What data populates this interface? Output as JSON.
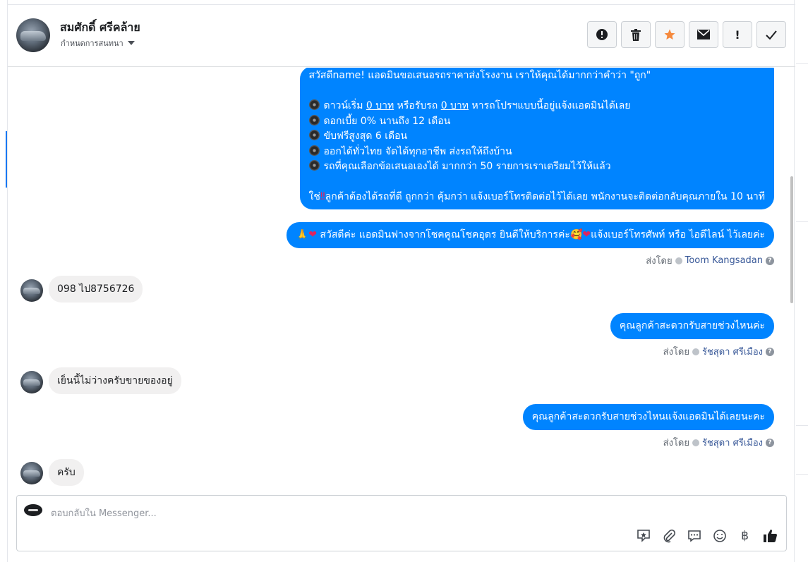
{
  "header": {
    "name": "สมศักดิ์ ศรีคล้าย",
    "subtitle": "กำหนดการสนทนา",
    "toolbar": {
      "alert_label": "!",
      "delete_label": "🗑",
      "star_label": "★",
      "mail_label": "✉",
      "important_label": "!",
      "done_label": "✓"
    }
  },
  "messages": {
    "promo": {
      "line1": "สวัสดีname! แอดมินขอเสนอรถราคาส่งโรงงาน เราให้คุณได้มากกว่าคำว่า \"ถูก\"",
      "l2a": "ดาวน์เริ่ม ",
      "l2b": "0 บาท",
      "l2c": " หรือรับรถ ",
      "l2d": "0 บาท",
      "l2e": " หารถโปรฯแบบนี้อยู่แจ้งแอดมินได้เลย",
      "l3": "ดอกเบี้ย 0% นานถึง 12 เดือน",
      "l4": "ขับฟรีสูงสุด 6 เดือน",
      "l5": "ออกได้ทั่วไทย จัดได้ทุกอาชีพ ส่งรถให้ถึงบ้าน",
      "l6": "รถที่คุณเลือกข้อเสนอเองได้ มากกว่า 50 รายการเราเตรียมไว้ให้แล้ว",
      "l7a": "ใช่",
      "l7mark": "‼",
      "l7b": "ลูกค้าต้องได้รถที่ดี ถูกกว่า คุ้มกว่า แจ้งเบอร์โทรติดต่อไว้ได้เลย พนักงานจะติดต่อกลับคุณภายใน 10 นาที"
    },
    "greeting": {
      "pray": "🙏",
      "heart": "❤",
      "text1": " สวัสดีค่ะ แอดมินฟางจากโชคคูณโชคอุดร ยินดีให้บริการค่ะ",
      "face": "🥰",
      "heart2": "❤",
      "text2": "แจ้งเบอร์โทรศัพท์ หรือ ไอดีไลน์  ไว้เลยค่ะ"
    },
    "sent_by_label": "ส่งโดย",
    "sender1": "Toom Kangsadan",
    "in1": "098  ไป8756726",
    "out1": "คุณลูกค้าสะดวกรับสายช่วงไหนค่ะ",
    "sender2": "รัชสุดา ศรีเมือง",
    "in2": "เย็นนี้ไม่ว่างครับขายของอยู่",
    "out2": "คุณลูกค้าสะดวกรับสายช่วงไหนแจ้งแอดมินได้เลยนะคะ",
    "sender3": "รัชสุดา ศรีเมือง",
    "in3": "ครับ",
    "help": "?"
  },
  "composer": {
    "placeholder": "ตอบกลับใน Messenger...",
    "icons": {
      "sticker": "✎",
      "attach": "📎",
      "quick_reply": "💬",
      "emoji": "☺",
      "payment": "฿",
      "like": "👍"
    }
  }
}
